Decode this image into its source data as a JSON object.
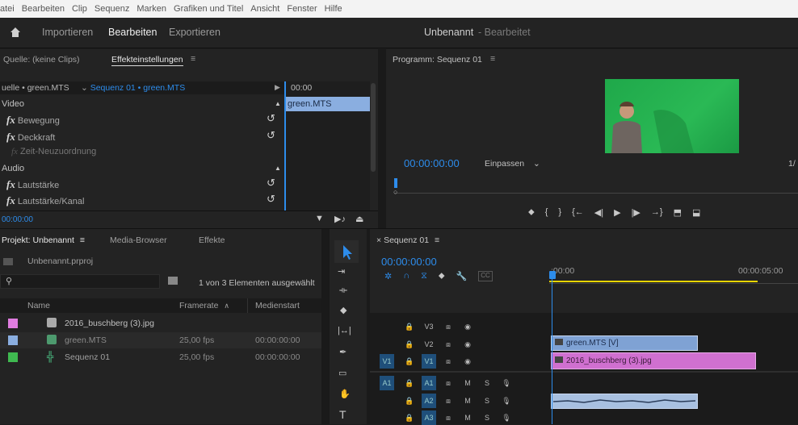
{
  "menu": [
    "atei",
    "Bearbeiten",
    "Clip",
    "Sequenz",
    "Marken",
    "Grafiken und Titel",
    "Ansicht",
    "Fenster",
    "Hilfe"
  ],
  "workspace": {
    "home_icon": "home-icon",
    "tabs": [
      "Importieren",
      "Bearbeiten",
      "Exportieren"
    ],
    "doc_name": "Unbenannt",
    "doc_state": "- Bearbeitet"
  },
  "source_panel": {
    "tab_source": "Quelle: (keine Clips)",
    "tab_effects": "Effekteinstellungen",
    "menu_icon": "≡",
    "source_label": "uelle • green.MTS",
    "sequence_label": "Sequenz 01 • green.MTS",
    "ruler_time": "00:00",
    "clip_name": "green.MTS",
    "sections": [
      {
        "label": "Video",
        "items": [
          "Bewegung",
          "Deckkraft",
          "Zeit-Neuzuordnung"
        ]
      },
      {
        "label": "Audio",
        "items": [
          "Lautstärke",
          "Lautstärke/Kanal"
        ]
      }
    ],
    "fx_symbol": "fx",
    "section_video": "Video",
    "section_audio": "Audio",
    "item_bewegung": "Bewegung",
    "item_deckkraft": "Deckkraft",
    "item_zeit": "Zeit-Neuzuordnung",
    "item_lautstaerke": "Lautstärke",
    "item_lautstaerke_kanal": "Lautstärke/Kanal",
    "timecode": "00:00:00"
  },
  "program_panel": {
    "title": "Programm: Sequenz 01",
    "menu_icon": "≡",
    "timecode": "00:00:00:00",
    "fit": "Einpassen",
    "fit_right": "1/"
  },
  "project_panel": {
    "tab_project": "Projekt: Unbenannt",
    "menu_icon": "≡",
    "tab_media": "Media-Browser",
    "tab_effects": "Effekte",
    "file": "Unbenannt.prproj",
    "search_placeholder": "",
    "count": "1 von 3 Elementen ausgewählt",
    "col_name": "Name",
    "col_framerate": "Framerate",
    "col_start": "Medienstart",
    "rows": [
      {
        "name": "2016_buschberg (3).jpg",
        "fps": "",
        "start": "",
        "color": "#e07de0"
      },
      {
        "name": "green.MTS",
        "fps": "25,00 fps",
        "start": "00:00:00:00",
        "color": "#8aaee0"
      },
      {
        "name": "Sequenz 01",
        "fps": "25,00 fps",
        "start": "00:00:00:00",
        "color": "#3fb950"
      }
    ]
  },
  "timeline": {
    "tab": "Sequenz 01",
    "close": "×",
    "menu_icon": "≡",
    "timecode": "00:00:00:00",
    "ruler_start": ":00:00",
    "ruler_end": "00:00:05:00",
    "tracks": [
      "V3",
      "V2",
      "V1",
      "A1",
      "A2",
      "A3"
    ],
    "src_v1": "V1",
    "src_a1": "A1",
    "lock": "🔒",
    "m": "M",
    "s": "S",
    "clip_v2": "green.MTS [V]",
    "clip_v1": "2016_buschberg (3).jpg",
    "cc": "CC"
  },
  "colors": {
    "accent": "#2d8ceb",
    "green_screen": "#22a54a",
    "clip_pink": "#d070d0",
    "clip_blue": "#7fa2d4"
  }
}
